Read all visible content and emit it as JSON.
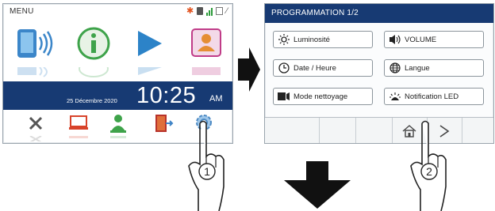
{
  "screen1": {
    "menu_label": "MENU",
    "date": "25 Décembre 2020",
    "time": "10:25",
    "ampm": "AM",
    "icons": [
      "monitor-call-icon",
      "info-icon",
      "play-icon",
      "contacts-icon"
    ],
    "bottom_icons": [
      "close-icon",
      "monitor-icon",
      "operator-icon",
      "exit-icon",
      "settings-gear-icon"
    ]
  },
  "screen2": {
    "title": "PROGRAMMATION 1/2",
    "buttons": [
      {
        "label": "Luminosité",
        "icon": "sun-icon"
      },
      {
        "label": "VOLUME",
        "icon": "speaker-icon"
      },
      {
        "label": "Date / Heure",
        "icon": "clock-icon"
      },
      {
        "label": "Langue",
        "icon": "globe-icon"
      },
      {
        "label": "Mode nettoyage",
        "icon": "cleaning-icon"
      },
      {
        "label": "Notification LED",
        "icon": "led-icon"
      }
    ]
  },
  "steps": {
    "step1": "1",
    "step2": "2"
  },
  "colors": {
    "navy": "#173a73",
    "orange": "#e25a1c"
  }
}
